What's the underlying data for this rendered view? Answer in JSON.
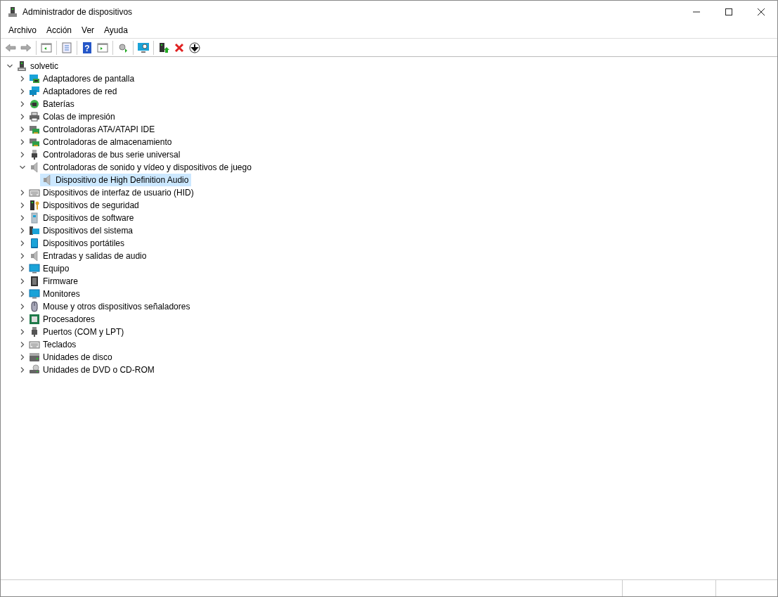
{
  "window": {
    "title": "Administrador de dispositivos"
  },
  "menu": [
    "Archivo",
    "Acción",
    "Ver",
    "Ayuda"
  ],
  "toolbar": {
    "help_glyph": "?"
  },
  "tree": {
    "label": "solvetic",
    "kind": "computer",
    "expanded": true,
    "selected": false,
    "children": [
      {
        "label": "Adaptadores de pantalla",
        "kind": "display",
        "expanded": false,
        "selected": false
      },
      {
        "label": "Adaptadores de red",
        "kind": "network",
        "expanded": false,
        "selected": false
      },
      {
        "label": "Baterías",
        "kind": "battery",
        "expanded": false,
        "selected": false
      },
      {
        "label": "Colas de impresión",
        "kind": "printer",
        "expanded": false,
        "selected": false
      },
      {
        "label": "Controladoras ATA/ATAPI IDE",
        "kind": "card",
        "expanded": false,
        "selected": false
      },
      {
        "label": "Controladoras de almacenamiento",
        "kind": "card",
        "expanded": false,
        "selected": false
      },
      {
        "label": "Controladoras de bus serie universal",
        "kind": "usb",
        "expanded": false,
        "selected": false
      },
      {
        "label": "Controladoras de sonido y vídeo y dispositivos de juego",
        "kind": "speaker",
        "expanded": true,
        "selected": false,
        "children": [
          {
            "label": "Dispositivo de High Definition Audio",
            "kind": "speaker",
            "selected": true
          }
        ]
      },
      {
        "label": "Dispositivos de interfaz de usuario (HID)",
        "kind": "keyboard",
        "expanded": false,
        "selected": false
      },
      {
        "label": "Dispositivos de seguridad",
        "kind": "security",
        "expanded": false,
        "selected": false
      },
      {
        "label": "Dispositivos de software",
        "kind": "software",
        "expanded": false,
        "selected": false
      },
      {
        "label": "Dispositivos del sistema",
        "kind": "system",
        "expanded": false,
        "selected": false
      },
      {
        "label": "Dispositivos portátiles",
        "kind": "portable",
        "expanded": false,
        "selected": false
      },
      {
        "label": "Entradas y salidas de audio",
        "kind": "speaker",
        "expanded": false,
        "selected": false
      },
      {
        "label": "Equipo",
        "kind": "monitor",
        "expanded": false,
        "selected": false
      },
      {
        "label": "Firmware",
        "kind": "chip",
        "expanded": false,
        "selected": false
      },
      {
        "label": "Monitores",
        "kind": "monitor",
        "expanded": false,
        "selected": false
      },
      {
        "label": "Mouse y otros dispositivos señaladores",
        "kind": "mouse",
        "expanded": false,
        "selected": false
      },
      {
        "label": "Procesadores",
        "kind": "cpu",
        "expanded": false,
        "selected": false
      },
      {
        "label": "Puertos (COM y LPT)",
        "kind": "port",
        "expanded": false,
        "selected": false
      },
      {
        "label": "Teclados",
        "kind": "keyboard",
        "expanded": false,
        "selected": false
      },
      {
        "label": "Unidades de disco",
        "kind": "disk",
        "expanded": false,
        "selected": false
      },
      {
        "label": "Unidades de DVD o CD-ROM",
        "kind": "dvd",
        "expanded": false,
        "selected": false
      }
    ]
  }
}
